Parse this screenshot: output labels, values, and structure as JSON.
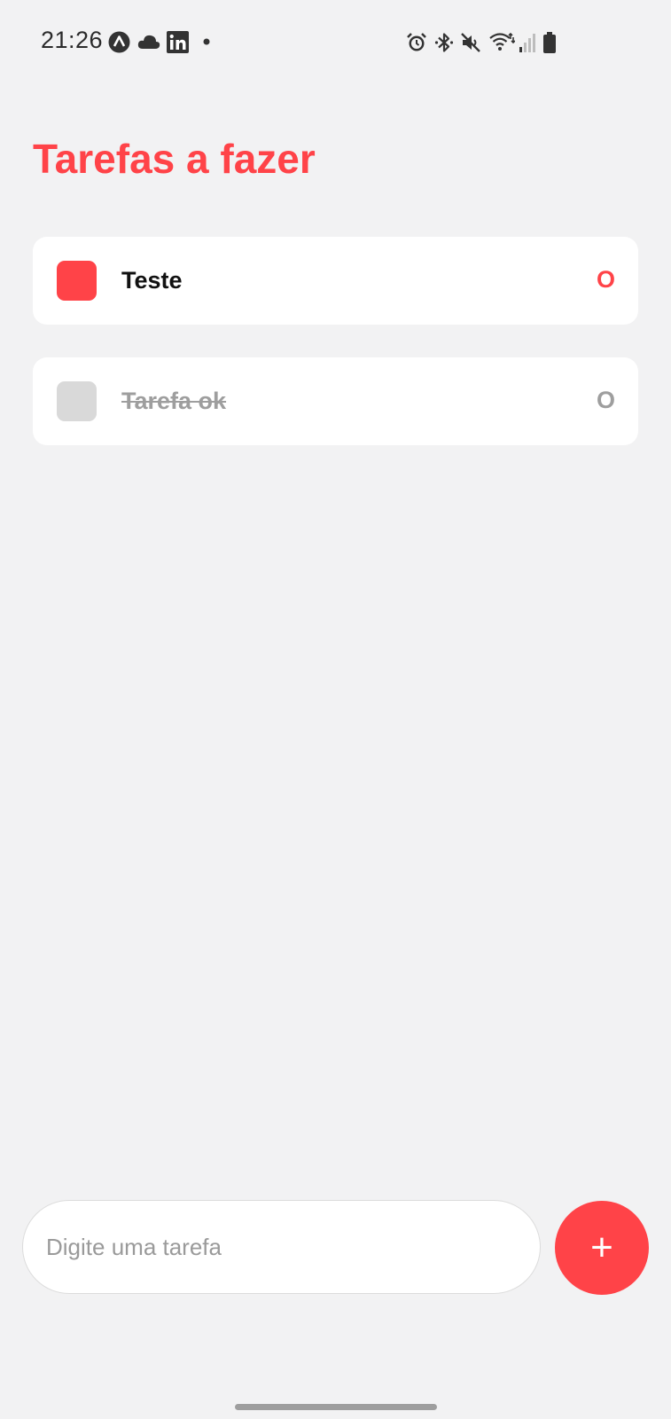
{
  "status_bar": {
    "time": "21:26",
    "left_icons": [
      "app-a-icon",
      "cloud-icon",
      "linkedin-icon",
      "notification-dot-icon"
    ],
    "right_icons": [
      "alarm-icon",
      "bluetooth-icon",
      "mute-icon",
      "wifi-icon",
      "signal-icon",
      "battery-icon"
    ]
  },
  "header": {
    "title": "Tarefas a fazer"
  },
  "tasks": [
    {
      "label": "Teste",
      "completed": false,
      "delete_label": "O"
    },
    {
      "label": "Tarefa ok",
      "completed": true,
      "delete_label": "O"
    }
  ],
  "composer": {
    "placeholder": "Digite uma tarefa",
    "value": "",
    "add_label": "+"
  },
  "colors": {
    "accent": "#ff4348",
    "background": "#f2f2f3",
    "card": "#ffffff",
    "done_check": "#d9d9d9",
    "done_text": "#9e9e9e"
  }
}
